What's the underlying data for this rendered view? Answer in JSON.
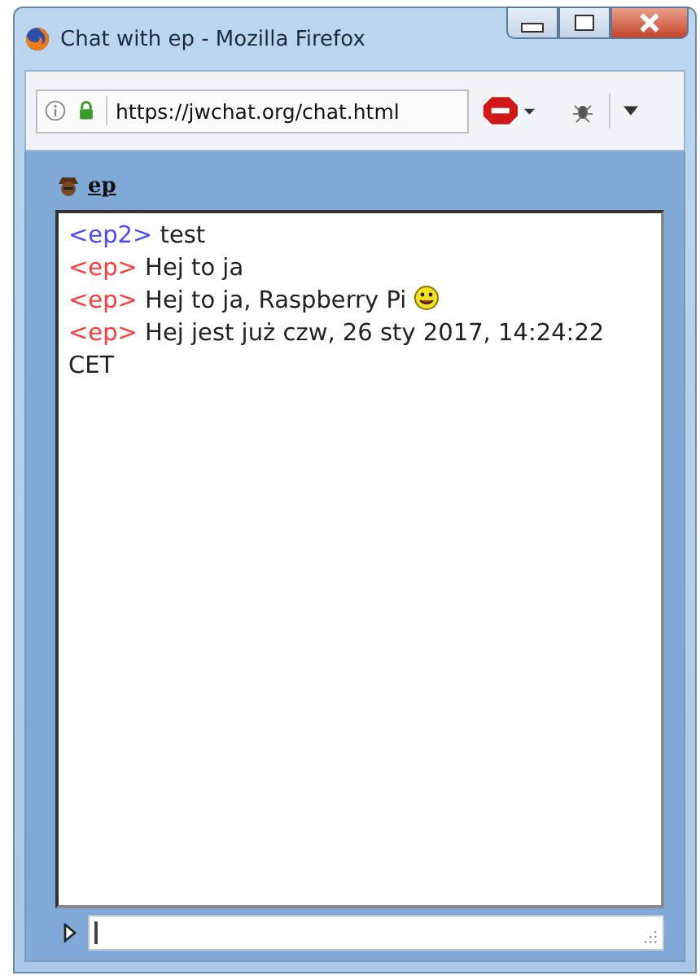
{
  "window": {
    "title": "Chat with ep - Mozilla Firefox"
  },
  "address_bar": {
    "url": "https://jwchat.org/chat.html"
  },
  "chat": {
    "contact": "ep",
    "messages": [
      {
        "sender": "<ep2>",
        "color": "#4a4aff",
        "text": "test",
        "smiley": false
      },
      {
        "sender": "<ep>",
        "color": "#ff3b3b",
        "text": "Hej to ja",
        "smiley": false
      },
      {
        "sender": "<ep>",
        "color": "#ff3b3b",
        "text": "Hej to ja, Raspberry Pi",
        "smiley": true
      },
      {
        "sender": "<ep>",
        "color": "#ff3b3b",
        "text": "Hej jest już czw, 26 sty 2017, 14:24:22 CET",
        "smiley": false
      }
    ]
  }
}
